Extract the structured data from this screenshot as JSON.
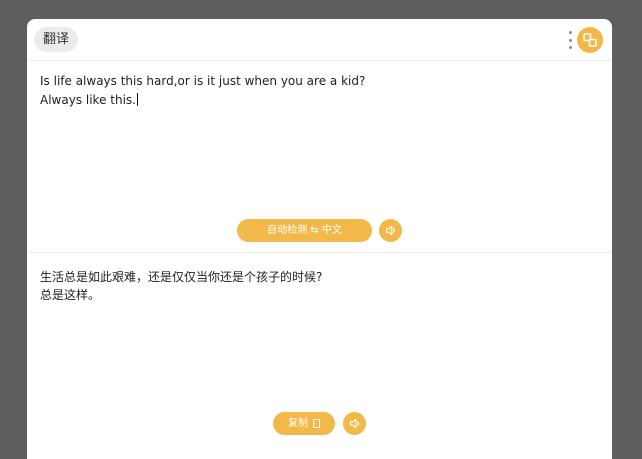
{
  "header": {
    "title": "翻译",
    "more_icon": "more-vertical-icon",
    "swap_icon": "swap-layout-icon",
    "accent_color": "#f2b94a"
  },
  "source": {
    "lines": [
      "Is life always this hard,or is it just when you are a kid?",
      "Always like this."
    ],
    "language_button": "自动检测 ⇆ 中文",
    "speak_icon": "speaker-icon"
  },
  "result": {
    "lines": [
      "生活总是如此艰难，还是仅仅当你还是个孩子的时候?",
      "总是这样。"
    ],
    "copy_label": "复制",
    "copy_icon": "copy-icon",
    "speak_icon": "speaker-icon"
  }
}
